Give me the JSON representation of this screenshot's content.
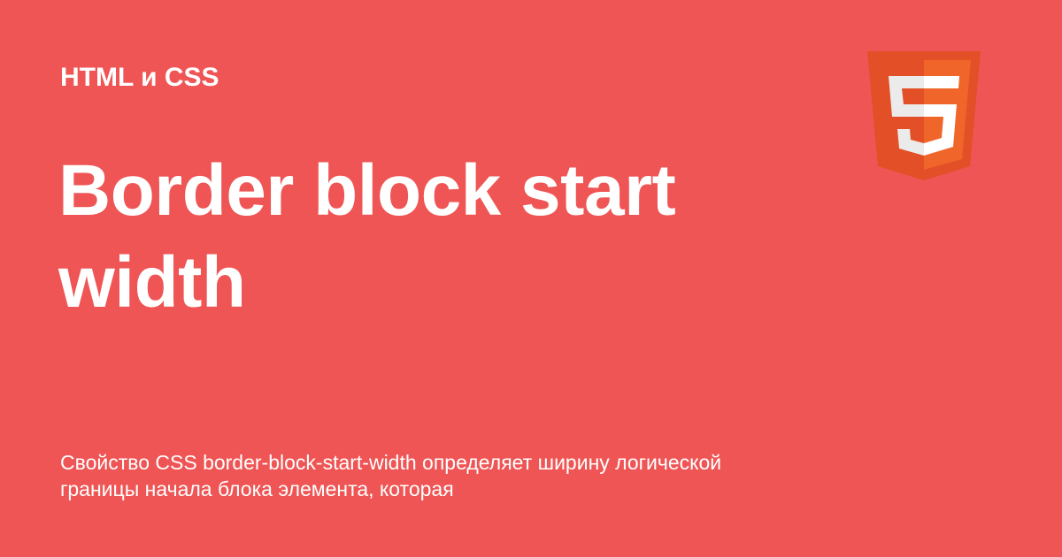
{
  "category": "HTML и CSS",
  "title": "Border block start width",
  "description": "Свойство CSS border-block-start-width определяет ширину логической границы начала блока элемента, которая",
  "logo": {
    "icon": "html5-logo-icon",
    "glyph": "5"
  },
  "colors": {
    "background": "#EF5555",
    "text": "#FFFFFF",
    "logo_dark": "#E34F26",
    "logo_light": "#EF652A",
    "logo_glyph": "#EBEBEB"
  }
}
